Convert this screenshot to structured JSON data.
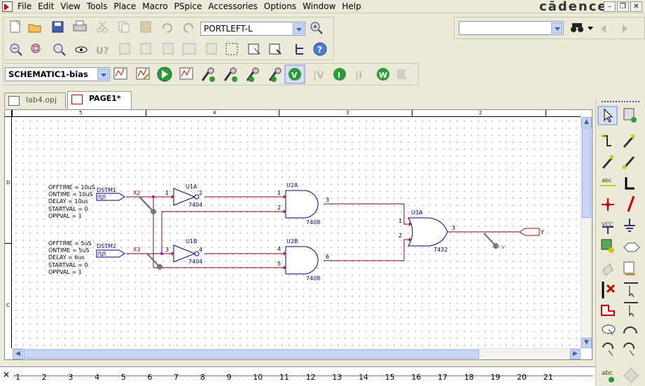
{
  "menubar": {
    "items": [
      "File",
      "Edit",
      "View",
      "Tools",
      "Place",
      "Macro",
      "PSpice",
      "Accessories",
      "Options",
      "Window",
      "Help"
    ],
    "brand": "cādence"
  },
  "toolbar": {
    "part_combo": "PORTLEFT-L",
    "search_combo": "",
    "profile_combo": "SCHEMATIC1-bias"
  },
  "tabs": [
    {
      "label": "lab4.opj"
    },
    {
      "label": "PAGE1*"
    }
  ],
  "ruler_top": [
    "5",
    "4",
    "3",
    "2"
  ],
  "ruler_left": [
    "D",
    "C"
  ],
  "schematic": {
    "stim1": {
      "lines": [
        "OFFTIME = 10uS",
        "ONTIME = 10uS",
        "DELAY = 10us",
        "STARTVAL = 0",
        "OPPVAL = 1"
      ],
      "ref": "DSTM1",
      "net": "X2"
    },
    "stim2": {
      "lines": [
        "OFFTIME = 5uS",
        "ONTIME = 5uS",
        "DELAY = 6us",
        "STARTVAL = 0",
        "OPPVAL = 1"
      ],
      "ref": "DSTM2",
      "net": "X3"
    },
    "u1a": {
      "ref": "U1A",
      "part": "7404",
      "pin_in": "1",
      "pin_out": "2"
    },
    "u1b": {
      "ref": "U1B",
      "part": "7404",
      "pin_in": "3",
      "pin_out": "4"
    },
    "u2a": {
      "ref": "U2A",
      "part": "7408",
      "pin_a": "1",
      "pin_b": "2",
      "pin_out": "3"
    },
    "u2b": {
      "ref": "U2B",
      "part": "7408",
      "pin_a": "4",
      "pin_b": "5",
      "pin_out": "6"
    },
    "u3a": {
      "ref": "U3A",
      "part": "7432",
      "pin_a": "1",
      "pin_b": "2",
      "pin_out": "3"
    },
    "out_port": "Y",
    "probe_label": "V"
  },
  "bottom_ruler": [
    "1",
    "2",
    "3",
    "4",
    "5",
    "6",
    "7",
    "8",
    "9",
    "10",
    "11",
    "12",
    "13",
    "14",
    "15",
    "16",
    "17",
    "18",
    "19",
    "20",
    "21"
  ],
  "colors": {
    "wire": "#800040",
    "part": "#000080",
    "net": "#c00000"
  }
}
